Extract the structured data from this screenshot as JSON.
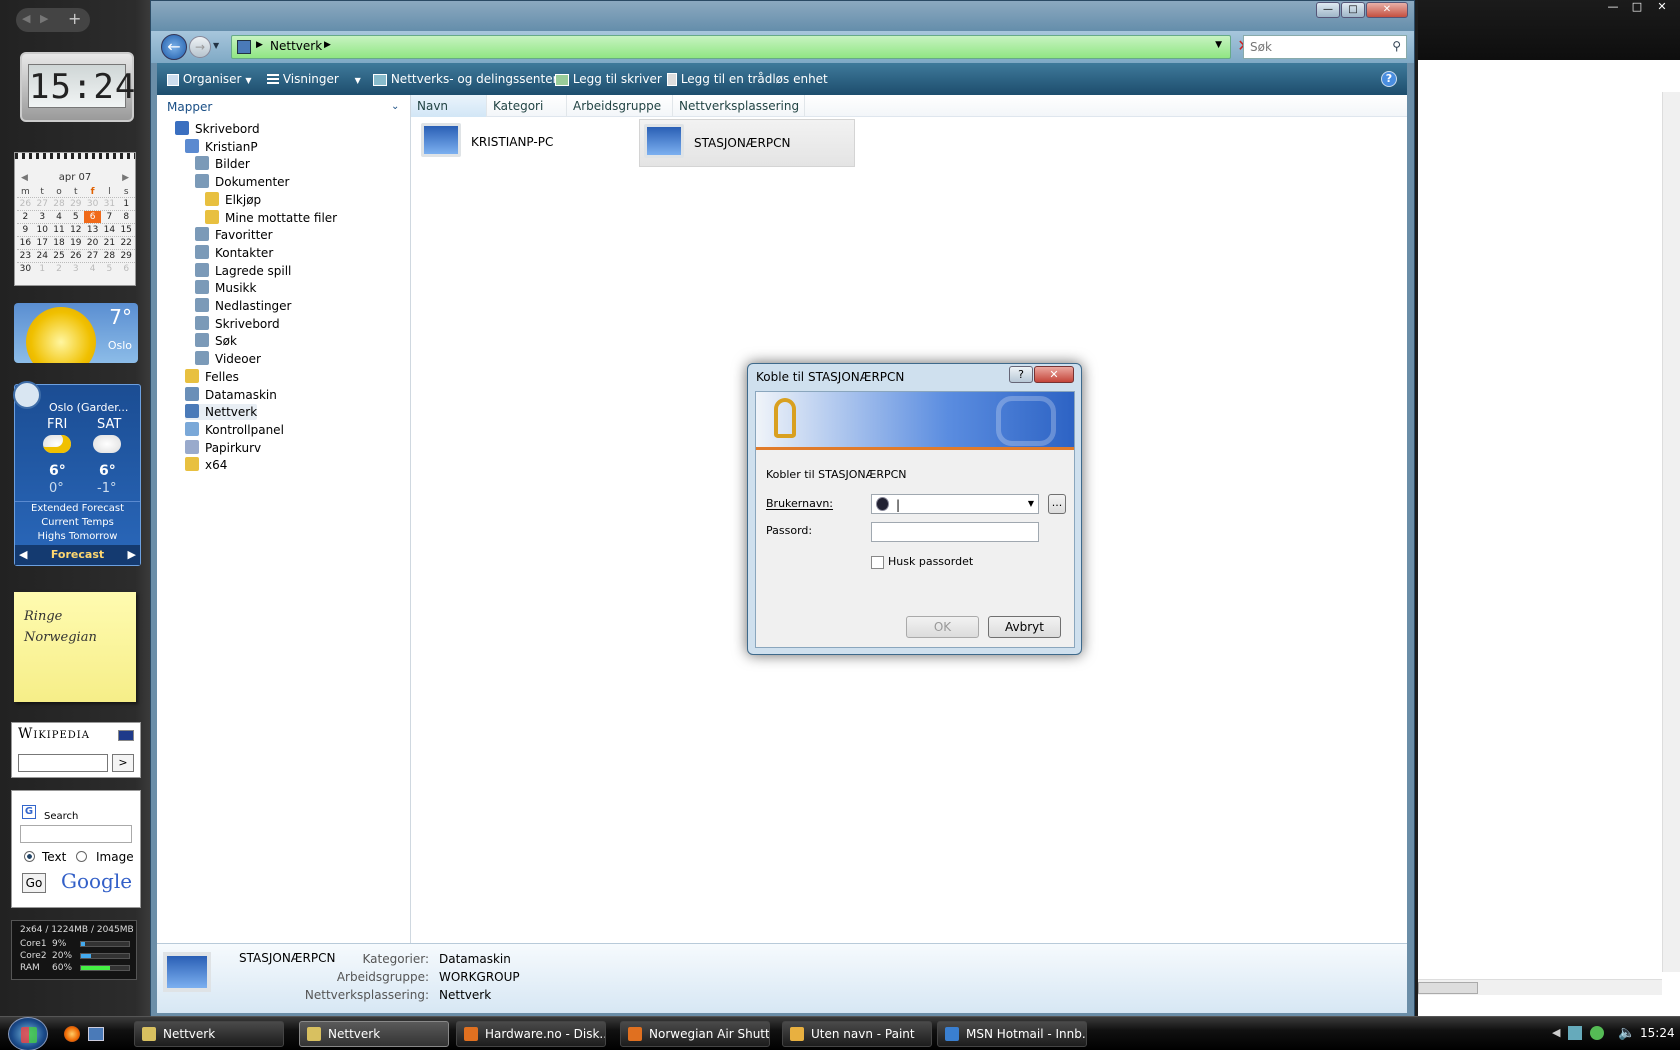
{
  "sidebar": {
    "clock": "15:24",
    "calendar": {
      "month": "apr 07",
      "days_header": [
        "m",
        "t",
        "o",
        "t",
        "f",
        "l",
        "s"
      ],
      "weeks": [
        [
          "26",
          "27",
          "28",
          "29",
          "30",
          "31",
          "1"
        ],
        [
          "2",
          "3",
          "4",
          "5",
          "6",
          "7",
          "8"
        ],
        [
          "9",
          "10",
          "11",
          "12",
          "13",
          "14",
          "15"
        ],
        [
          "16",
          "17",
          "18",
          "19",
          "20",
          "21",
          "22"
        ],
        [
          "23",
          "24",
          "25",
          "26",
          "27",
          "28",
          "29"
        ],
        [
          "30",
          "1",
          "2",
          "3",
          "4",
          "5",
          "6"
        ]
      ],
      "today": "6"
    },
    "weather1": {
      "temp": "7°",
      "city": "Oslo"
    },
    "weather2": {
      "location": "Oslo (Garder...",
      "day1": "FRI",
      "day2": "SAT",
      "hi1": "6°",
      "hi2": "6°",
      "lo1": "0°",
      "lo2": "-1°",
      "link1": "Extended Forecast",
      "link2": "Current Temps",
      "link3": "Highs Tomorrow",
      "footer": "Forecast"
    },
    "note": {
      "line1": "Ringe",
      "line2": "Norwegian"
    },
    "wikipedia": {
      "title": "Wikipedia",
      "go": ">"
    },
    "google": {
      "label": "Search",
      "opt1": "Text",
      "opt2": "Image",
      "go": "Go",
      "logo": "Google"
    },
    "meter": {
      "header": "2x64 / 1224MB / 2045MB",
      "rows": [
        {
          "label": "Core1",
          "value": "9%",
          "fill": 0.09
        },
        {
          "label": "Core2",
          "value": "20%",
          "fill": 0.2
        },
        {
          "label": "RAM",
          "value": "60%",
          "fill": 0.6
        }
      ]
    }
  },
  "window": {
    "address": {
      "crumb": "Nettverk"
    },
    "search_placeholder": "Søk",
    "toolbar": {
      "organize": "Organiser",
      "views": "Visninger",
      "network_center": "Nettverks- og delingssenter",
      "add_printer": "Legg til skriver",
      "add_wireless": "Legg til en trådløs enhet"
    },
    "nav": {
      "header": "Mapper",
      "items": [
        {
          "label": "Skrivebord",
          "indent": 0
        },
        {
          "label": "KristianP",
          "indent": 1
        },
        {
          "label": "Bilder",
          "indent": 2
        },
        {
          "label": "Dokumenter",
          "indent": 2
        },
        {
          "label": "Elkjøp",
          "indent": 3
        },
        {
          "label": "Mine mottatte filer",
          "indent": 3
        },
        {
          "label": "Favoritter",
          "indent": 2
        },
        {
          "label": "Kontakter",
          "indent": 2
        },
        {
          "label": "Lagrede spill",
          "indent": 2
        },
        {
          "label": "Musikk",
          "indent": 2
        },
        {
          "label": "Nedlastinger",
          "indent": 2
        },
        {
          "label": "Skrivebord",
          "indent": 2
        },
        {
          "label": "Søk",
          "indent": 2
        },
        {
          "label": "Videoer",
          "indent": 2
        },
        {
          "label": "Felles",
          "indent": 1
        },
        {
          "label": "Datamaskin",
          "indent": 1
        },
        {
          "label": "Nettverk",
          "indent": 1
        },
        {
          "label": "Kontrollpanel",
          "indent": 1
        },
        {
          "label": "Papirkurv",
          "indent": 1
        },
        {
          "label": "x64",
          "indent": 1
        }
      ]
    },
    "columns": [
      "Navn",
      "Kategori",
      "Arbeidsgruppe",
      "Nettverksplassering"
    ],
    "items": [
      "KRISTIANP-PC",
      "STASJONÆRPCN"
    ],
    "details": {
      "name": "STASJONÆRPCN",
      "category_label": "Kategorier:",
      "category": "Datamaskin",
      "workgroup_label": "Arbeidsgruppe:",
      "workgroup": "WORKGROUP",
      "location_label": "Nettverksplassering:",
      "location": "Nettverk"
    }
  },
  "dialog": {
    "title": "Koble til STASJONÆRPCN",
    "help": "?",
    "message": "Kobler til STASJONÆRPCN",
    "username_label": "Brukernavn:",
    "password_label": "Passord:",
    "remember": "Husk passordet",
    "browse": "...",
    "ok": "OK",
    "cancel": "Avbryt"
  },
  "taskbar": {
    "tasks": [
      {
        "label": "Nettverk",
        "active": false,
        "color": "#d8c060"
      },
      {
        "label": "Nettverk",
        "active": true,
        "color": "#d8c060"
      },
      {
        "label": "Hardware.no - Disk...",
        "active": false,
        "color": "#e07020"
      },
      {
        "label": "Norwegian Air Shutt...",
        "active": false,
        "color": "#e07020"
      },
      {
        "label": "Uten navn - Paint",
        "active": false,
        "color": "#e8b040"
      },
      {
        "label": "MSN Hotmail - Innb...",
        "active": false,
        "color": "#3a7fd0"
      }
    ],
    "time": "15:24"
  }
}
